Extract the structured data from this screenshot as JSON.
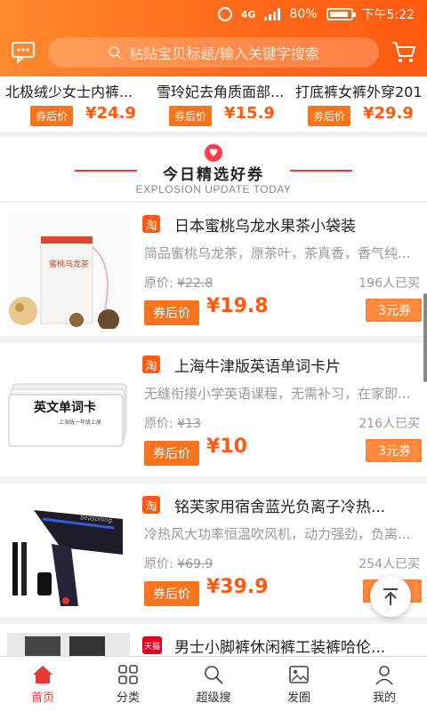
{
  "status": {
    "signal": "4G",
    "battery": "80%",
    "time": "下午5:22"
  },
  "search": {
    "placeholder": "粘贴宝贝标题/输入关键字搜索"
  },
  "top_row": [
    {
      "title": "北极绒少女士内裤...",
      "after_label": "券后价",
      "price": "¥24.9"
    },
    {
      "title": "雪玲妃去角质面部...",
      "after_label": "券后价",
      "price": "¥15.9"
    },
    {
      "title": "打底裤女裤外穿201",
      "after_label": "券后价",
      "price": "¥29.9"
    }
  ],
  "section": {
    "title": "今日精选好券",
    "subtitle": "EXPLOSION UPDATE TODAY"
  },
  "thumb_text": {
    "tea": "蜜桃乌龙茶",
    "cards": "英文单词卡",
    "cards_sub": "上海版一年级上册",
    "hairdryer_brand": "Seasoning",
    "tmall_badge": "天猫"
  },
  "items": [
    {
      "source": "淘",
      "title": "日本蜜桃乌龙水果茶小袋装",
      "desc": "简品蜜桃乌龙茶，原茶叶，茶真香，香气纯...",
      "orig_label": "原价:",
      "orig_price": "¥22.8",
      "sold": "196人已买",
      "after_label": "券后价",
      "price": "¥19.8",
      "coupon": "3元券"
    },
    {
      "source": "淘",
      "title": "上海牛津版英语单词卡片",
      "desc": "无缝衔接小学英语课程，无需补习，在家即...",
      "orig_label": "原价:",
      "orig_price": "¥13",
      "sold": "216人已买",
      "after_label": "券后价",
      "price": "¥10",
      "coupon": "3元券"
    },
    {
      "source": "淘",
      "title": "铭芙家用宿舍蓝光负离子冷热...",
      "desc": "冷热风大功率恒温吹风机，动力强劲，负离...",
      "orig_label": "原价:",
      "orig_price": "¥69.9",
      "sold": "254人已买",
      "after_label": "券后价",
      "price": "¥39.9",
      "coupon": ""
    },
    {
      "source": "天猫",
      "title": "男士小脚裤休闲裤工装裤哈伦..."
    }
  ],
  "tabs": [
    {
      "label": "首页",
      "icon": "home-icon"
    },
    {
      "label": "分类",
      "icon": "grid-icon"
    },
    {
      "label": "超级搜",
      "icon": "super-search-icon"
    },
    {
      "label": "发圈",
      "icon": "moments-icon"
    },
    {
      "label": "我的",
      "icon": "person-icon"
    }
  ],
  "colors": {
    "accent": "#ff5a10",
    "header_start": "#ff8a2e",
    "active_tab": "#e83a32"
  }
}
